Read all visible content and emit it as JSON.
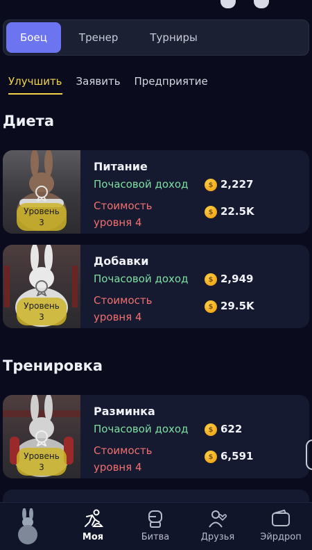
{
  "main_tabs": [
    {
      "label": "Боец",
      "active": true
    },
    {
      "label": "Тренер",
      "active": false
    },
    {
      "label": "Турниры",
      "active": false
    }
  ],
  "sub_tabs": [
    {
      "label": "Улучшить",
      "active": true
    },
    {
      "label": "Заявить",
      "active": false
    },
    {
      "label": "Предприятие",
      "active": false
    }
  ],
  "sections": [
    {
      "title": "Диета",
      "cards": [
        {
          "name": "Питание",
          "income_label": "Почасовой доход",
          "income": "2,227",
          "cost_label": "Стоимость уровня 4",
          "cost": "22.5K",
          "level_label": "Уровень",
          "level": "3"
        },
        {
          "name": "Добавки",
          "income_label": "Почасовой доход",
          "income": "2,949",
          "cost_label": "Стоимость уровня 4",
          "cost": "29.5K",
          "level_label": "Уровень",
          "level": "3"
        }
      ]
    },
    {
      "title": "Тренировка",
      "cards": [
        {
          "name": "Разминка",
          "income_label": "Почасовой доход",
          "income": "622",
          "cost_label": "Стоимость уровня 4",
          "cost": "6,591",
          "level_label": "Уровень",
          "level": "3"
        }
      ]
    }
  ],
  "bottom_nav": [
    {
      "icon": "fighter-avatar-icon",
      "label": ""
    },
    {
      "icon": "fighter-icon",
      "label": "Моя",
      "active": true
    },
    {
      "icon": "boxing-glove-icon",
      "label": "Битва"
    },
    {
      "icon": "friends-icon",
      "label": "Друзья"
    },
    {
      "icon": "wallet-icon",
      "label": "Эйрдроп"
    }
  ],
  "colors": {
    "accent": "#6d74f0",
    "tab_underline": "#f4d34a",
    "income": "#7ee0a0",
    "cost": "#f07070",
    "level_pill": "#cdb428"
  }
}
